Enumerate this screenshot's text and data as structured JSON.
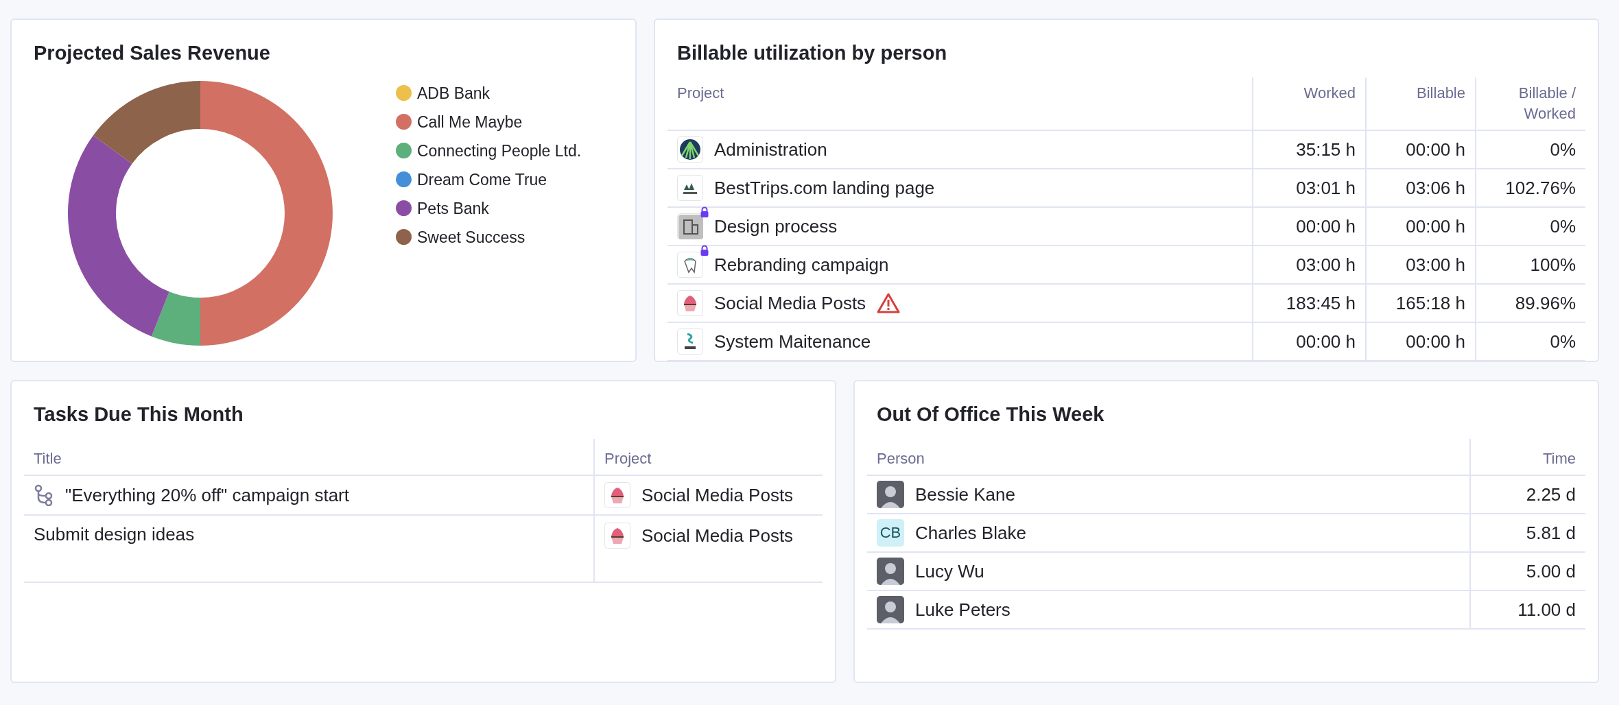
{
  "sales_revenue": {
    "title": "Projected Sales Revenue",
    "legend": [
      {
        "label": "ADB Bank",
        "color": "#ecc04b"
      },
      {
        "label": "Call Me Maybe",
        "color": "#d27064"
      },
      {
        "label": "Connecting People Ltd.",
        "color": "#5daf7b"
      },
      {
        "label": "Dream Come True",
        "color": "#4490d8"
      },
      {
        "label": "Pets Bank",
        "color": "#894ea4"
      },
      {
        "label": "Sweet Success",
        "color": "#8e634b"
      }
    ]
  },
  "billable": {
    "title": "Billable utilization by person",
    "columns": [
      "Project",
      "Worked",
      "Billable",
      "Billable / Worked"
    ],
    "rows": [
      {
        "project": "Administration",
        "locked": false,
        "warning": false,
        "worked": "35:15 h",
        "billable": "00:00 h",
        "ratio": "0%"
      },
      {
        "project": "BestTrips.com landing page",
        "locked": false,
        "warning": false,
        "worked": "03:01 h",
        "billable": "03:06 h",
        "ratio": "102.76%"
      },
      {
        "project": "Design process",
        "locked": true,
        "warning": false,
        "worked": "00:00 h",
        "billable": "00:00 h",
        "ratio": "0%"
      },
      {
        "project": "Rebranding campaign",
        "locked": true,
        "warning": false,
        "worked": "03:00 h",
        "billable": "03:00 h",
        "ratio": "100%"
      },
      {
        "project": "Social Media Posts",
        "locked": false,
        "warning": true,
        "worked": "183:45 h",
        "billable": "165:18 h",
        "ratio": "89.96%"
      },
      {
        "project": "System Maitenance",
        "locked": false,
        "warning": false,
        "worked": "00:00 h",
        "billable": "00:00 h",
        "ratio": "0%"
      }
    ]
  },
  "tasks": {
    "title": "Tasks Due This Month",
    "columns": [
      "Title",
      "Project"
    ],
    "rows": [
      {
        "kind": "linked",
        "title": "\"Everything 20% off\" campaign start",
        "project": "Social Media Posts"
      },
      {
        "kind": "plain",
        "title": "Submit design ideas",
        "project": "Social Media Posts"
      }
    ]
  },
  "out_of_office": {
    "title": "Out Of Office This Week",
    "columns": [
      "Person",
      "Time"
    ],
    "rows": [
      {
        "person": "Bessie Kane",
        "avatar": {
          "kind": "photo"
        },
        "time": "2.25 d"
      },
      {
        "person": "Charles Blake",
        "avatar": {
          "kind": "initials",
          "text": "CB"
        },
        "time": "5.81 d"
      },
      {
        "person": "Lucy Wu",
        "avatar": {
          "kind": "photo"
        },
        "time": "5.00 d"
      },
      {
        "person": "Luke Peters",
        "avatar": {
          "kind": "photo"
        },
        "time": "11.00 d"
      }
    ]
  }
}
